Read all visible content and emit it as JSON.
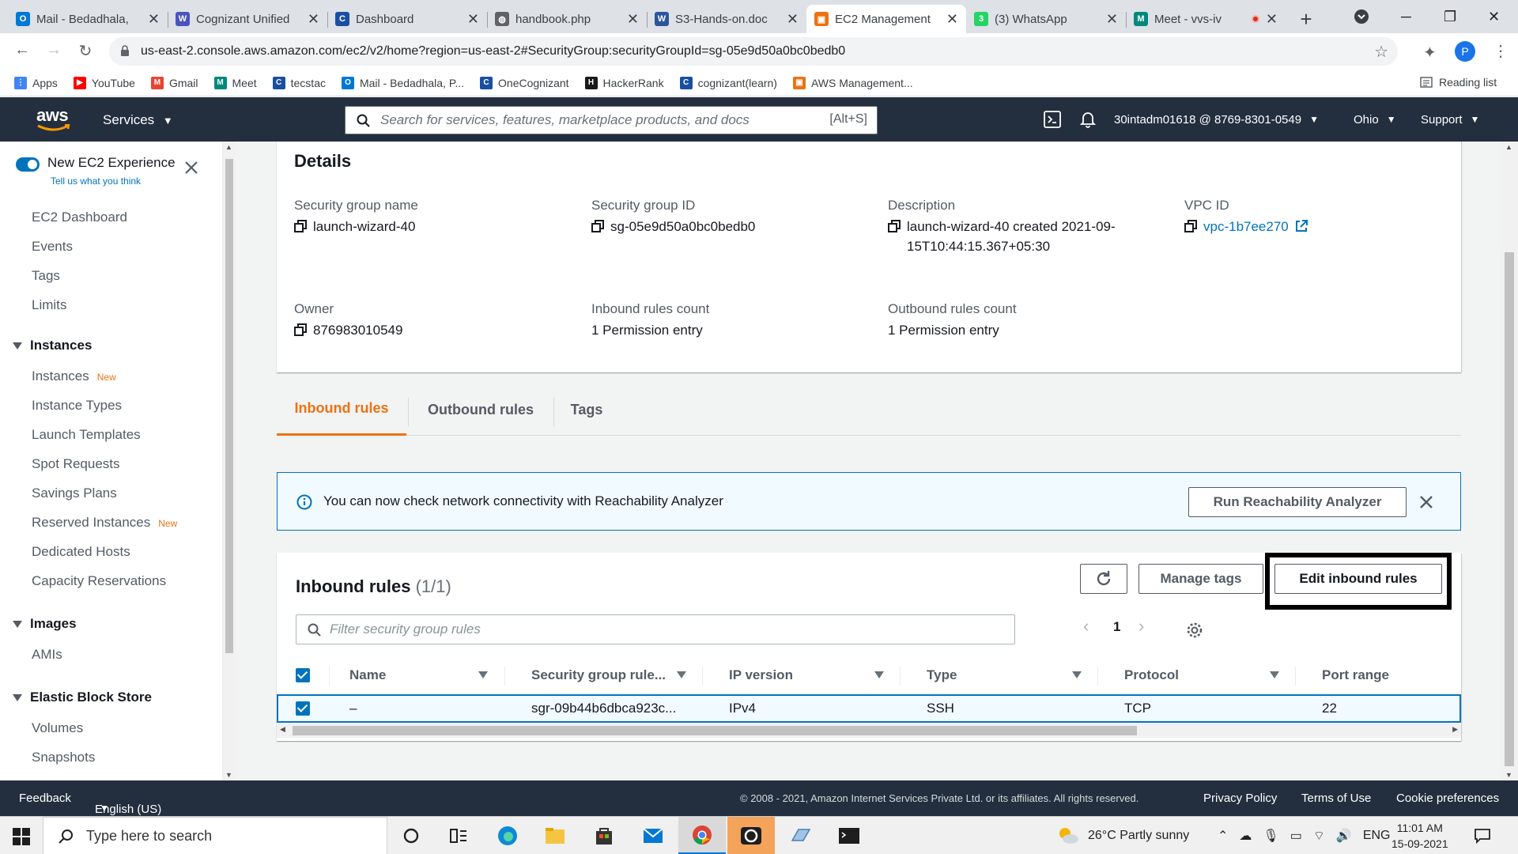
{
  "browser": {
    "tabs": [
      {
        "title": "Mail - Bedadhala,",
        "favicon_color": "#0078d4",
        "favicon_char": "O"
      },
      {
        "title": "Cognizant Unified",
        "favicon_color": "#4b53bc",
        "favicon_char": "W"
      },
      {
        "title": "Dashboard",
        "favicon_color": "#1a4fa0",
        "favicon_char": "C"
      },
      {
        "title": "handbook.php",
        "favicon_color": "#5f6368",
        "favicon_char": "◍"
      },
      {
        "title": "S3-Hands-on.doc",
        "favicon_color": "#2b579a",
        "favicon_char": "W"
      },
      {
        "title": "EC2 Management",
        "favicon_color": "#ec7211",
        "favicon_char": "▣",
        "active": true
      },
      {
        "title": "(3) WhatsApp",
        "favicon_color": "#25d366",
        "favicon_char": "3"
      },
      {
        "title": "Meet - vvs-iv",
        "favicon_color": "#00897b",
        "favicon_char": "M",
        "recording": true
      }
    ],
    "url": "us-east-2.console.aws.amazon.com/ec2/v2/home?region=us-east-2#SecurityGroup:securityGroupId=sg-05e9d50a0bc0bedb0",
    "profile_initial": "P",
    "bookmarks": [
      {
        "label": "Apps",
        "color": "#4285f4",
        "char": "⋮"
      },
      {
        "label": "YouTube",
        "color": "#ff0000",
        "char": "▶"
      },
      {
        "label": "Gmail",
        "color": "#ea4335",
        "char": "M"
      },
      {
        "label": "Meet",
        "color": "#00897b",
        "char": "M"
      },
      {
        "label": "tecstac",
        "color": "#1a4fa0",
        "char": "C"
      },
      {
        "label": "Mail - Bedadhala, P...",
        "color": "#0078d4",
        "char": "O"
      },
      {
        "label": "OneCognizant",
        "color": "#1a4fa0",
        "char": "C"
      },
      {
        "label": "HackerRank",
        "color": "#1a1a1a",
        "char": "H"
      },
      {
        "label": "cognizant(learn)",
        "color": "#1a4fa0",
        "char": "C"
      },
      {
        "label": "AWS Management...",
        "color": "#ec7211",
        "char": "▣"
      }
    ],
    "reading_list": "Reading list"
  },
  "aws_header": {
    "logo": "aws",
    "services": "Services",
    "search_placeholder": "Search for services, features, marketplace products, and docs",
    "search_shortcut": "[Alt+S]",
    "account": "30intadm01618 @ 8769-8301-0549",
    "region": "Ohio",
    "support": "Support"
  },
  "sidebar": {
    "new_experience_title": "New EC2 Experience",
    "new_experience_sub": "Tell us what you think",
    "new_badge": "New",
    "top_items": [
      "EC2 Dashboard",
      "Events",
      "Tags",
      "Limits"
    ],
    "sections": [
      {
        "title": "Instances",
        "items": [
          {
            "label": "Instances",
            "new": true
          },
          {
            "label": "Instance Types"
          },
          {
            "label": "Launch Templates"
          },
          {
            "label": "Spot Requests"
          },
          {
            "label": "Savings Plans"
          },
          {
            "label": "Reserved Instances",
            "new": true
          },
          {
            "label": "Dedicated Hosts"
          },
          {
            "label": "Capacity Reservations"
          }
        ]
      },
      {
        "title": "Images",
        "items": [
          {
            "label": "AMIs"
          }
        ]
      },
      {
        "title": "Elastic Block Store",
        "items": [
          {
            "label": "Volumes"
          },
          {
            "label": "Snapshots"
          }
        ]
      }
    ]
  },
  "details": {
    "title": "Details",
    "fields": {
      "sg_name": {
        "label": "Security group name",
        "value": "launch-wizard-40"
      },
      "sg_id": {
        "label": "Security group ID",
        "value": "sg-05e9d50a0bc0bedb0"
      },
      "description": {
        "label": "Description",
        "value_line1": "launch-wizard-40 created 2021-09-",
        "value_line2": "15T10:44:15.367+05:30"
      },
      "vpc_id": {
        "label": "VPC ID",
        "value": "vpc-1b7ee270"
      },
      "owner": {
        "label": "Owner",
        "value": "876983010549"
      },
      "inbound_count": {
        "label": "Inbound rules count",
        "value": "1 Permission entry"
      },
      "outbound_count": {
        "label": "Outbound rules count",
        "value": "1 Permission entry"
      }
    }
  },
  "tabs": {
    "inbound": "Inbound rules",
    "outbound": "Outbound rules",
    "tags": "Tags"
  },
  "flash": {
    "message": "You can now check network connectivity with Reachability Analyzer",
    "button": "Run Reachability Analyzer"
  },
  "rules": {
    "title": "Inbound rules",
    "count": "(1/1)",
    "manage_tags": "Manage tags",
    "edit_inbound": "Edit inbound rules",
    "filter_placeholder": "Filter security group rules",
    "page": "1",
    "columns": [
      "Name",
      "Security group rule...",
      "IP version",
      "Type",
      "Protocol",
      "Port range"
    ],
    "rows": [
      {
        "name": "–",
        "rule_id": "sgr-09b44b6dbca923c...",
        "ip_version": "IPv4",
        "type": "SSH",
        "protocol": "TCP",
        "port_range": "22"
      }
    ]
  },
  "footer": {
    "feedback": "Feedback",
    "language": "English (US)",
    "copyright": "© 2008 - 2021, Amazon Internet Services Private Ltd. or its affiliates. All rights reserved.",
    "privacy": "Privacy Policy",
    "terms": "Terms of Use",
    "cookies": "Cookie preferences"
  },
  "taskbar": {
    "search_placeholder": "Type here to search",
    "weather": "26°C  Partly sunny",
    "lang": "ENG",
    "time": "11:01 AM",
    "date": "15-09-2021"
  },
  "colors": {
    "aws_dark": "#232f3e",
    "aws_orange": "#ec7211",
    "aws_blue": "#0073bb"
  }
}
